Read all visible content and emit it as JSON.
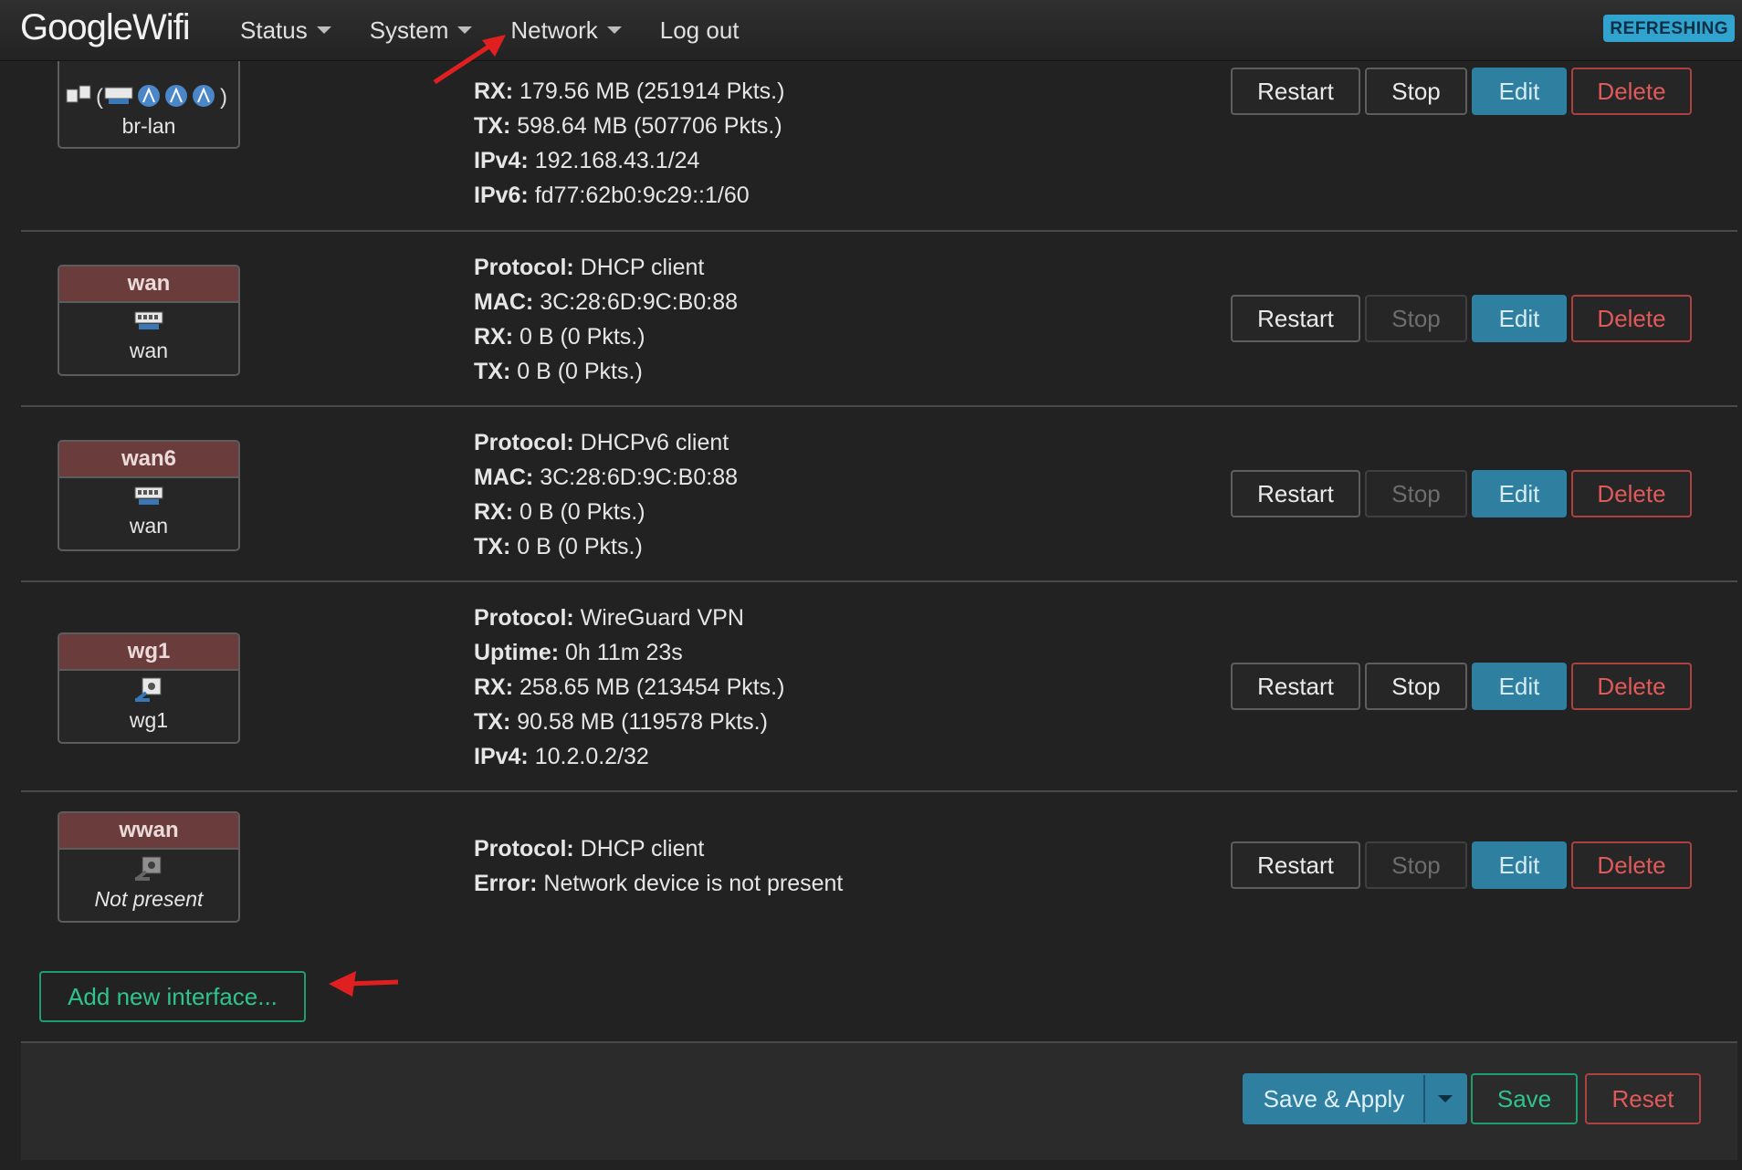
{
  "header": {
    "brand": "GoogleWifi",
    "nav": [
      "Status",
      "System",
      "Network",
      "Log out"
    ],
    "badge": "REFRESHING"
  },
  "buttons": {
    "restart": "Restart",
    "stop": "Stop",
    "edit": "Edit",
    "delete": "Delete"
  },
  "interfaces": [
    {
      "device": "br-lan",
      "info": [
        {
          "label": "RX:",
          "value": "179.56 MB (251914 Pkts.)"
        },
        {
          "label": "TX:",
          "value": "598.64 MB (507706 Pkts.)"
        },
        {
          "label": "IPv4:",
          "value": "192.168.43.1/24"
        },
        {
          "label": "IPv6:",
          "value": "fd77:62b0:9c29::1/60"
        }
      ],
      "stop_enabled": true
    },
    {
      "name": "wan",
      "device": "wan",
      "info": [
        {
          "label": "Protocol:",
          "value": "DHCP client"
        },
        {
          "label": "MAC:",
          "value": "3C:28:6D:9C:B0:88"
        },
        {
          "label": "RX:",
          "value": "0 B (0 Pkts.)"
        },
        {
          "label": "TX:",
          "value": "0 B (0 Pkts.)"
        }
      ],
      "stop_enabled": false
    },
    {
      "name": "wan6",
      "device": "wan",
      "info": [
        {
          "label": "Protocol:",
          "value": "DHCPv6 client"
        },
        {
          "label": "MAC:",
          "value": "3C:28:6D:9C:B0:88"
        },
        {
          "label": "RX:",
          "value": "0 B (0 Pkts.)"
        },
        {
          "label": "TX:",
          "value": "0 B (0 Pkts.)"
        }
      ],
      "stop_enabled": false
    },
    {
      "name": "wg1",
      "device": "wg1",
      "info": [
        {
          "label": "Protocol:",
          "value": "WireGuard VPN"
        },
        {
          "label": "Uptime:",
          "value": "0h 11m 23s"
        },
        {
          "label": "RX:",
          "value": "258.65 MB (213454 Pkts.)"
        },
        {
          "label": "TX:",
          "value": "90.58 MB (119578 Pkts.)"
        },
        {
          "label": "IPv4:",
          "value": "10.2.0.2/32"
        }
      ],
      "stop_enabled": true
    },
    {
      "name": "wwan",
      "device": "Not present",
      "info": [
        {
          "label": "Protocol:",
          "value": "DHCP client"
        },
        {
          "label": "Error:",
          "value": "Network device is not present"
        }
      ],
      "stop_enabled": false
    }
  ],
  "add_interface": "Add new interface...",
  "footer": {
    "save_apply": "Save & Apply",
    "save": "Save",
    "reset": "Reset"
  },
  "colors": {
    "background": "#222222",
    "edit_button": "#2f7fa1",
    "delete_border": "#b04040",
    "save_green": "#2fc48c",
    "badge": "#30a3cf",
    "iface_header": "#6b3c3c",
    "annotation_arrow": "#e02020"
  }
}
